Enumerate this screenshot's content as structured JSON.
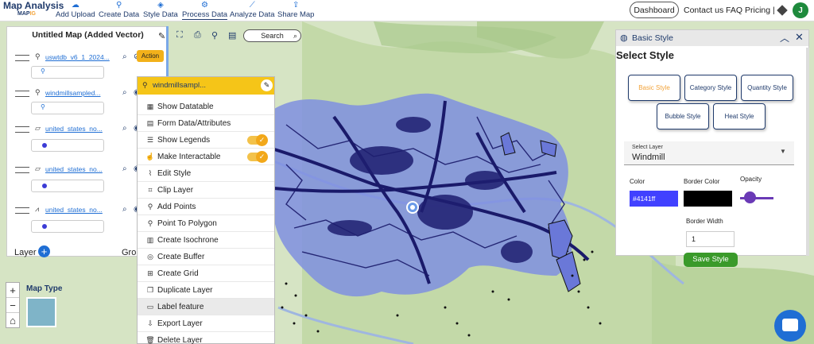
{
  "app": {
    "logo_line1": "Map Analysis",
    "logo_line2a": "MAP",
    "logo_line2b": "IG"
  },
  "nav": {
    "items": [
      {
        "label": "Add Upload",
        "icon": "upload-cloud-icon"
      },
      {
        "label": "Create Data",
        "icon": "location-pin-icon"
      },
      {
        "label": "Style Data",
        "icon": "paint-bucket-icon"
      },
      {
        "label": "Process Data",
        "icon": "process-nodes-icon"
      },
      {
        "label": "Analyze Data",
        "icon": "analyze-chart-icon"
      },
      {
        "label": "Share Map",
        "icon": "share-icon"
      }
    ],
    "active": "Process Data",
    "dashboard": "Dashboard",
    "contact": "Contact us",
    "faq": "FAQ",
    "pricing": "Pricing |",
    "avatar_letter": "J"
  },
  "layer_panel": {
    "title": "Untitled Map (Added Vector)",
    "action_label": "Action",
    "layers": [
      {
        "name": "uswtdb_v6_1_2024...",
        "geom": "point",
        "swatch": "pin"
      },
      {
        "name": "windmillsampled...",
        "geom": "point",
        "swatch": "pin"
      },
      {
        "name": "united_states_no...",
        "geom": "polygon",
        "swatch": "dot"
      },
      {
        "name": "united_states_no...",
        "geom": "polygon",
        "swatch": "dot"
      },
      {
        "name": "united_states_no...",
        "geom": "line",
        "swatch": "dot"
      }
    ],
    "layer_tab": "Layer",
    "group_tab": "Gro"
  },
  "toolbar": {
    "search_label": "Search"
  },
  "context_menu": {
    "layer_name": "windmillsampl...",
    "items": [
      {
        "label": "Show Datatable",
        "icon": "table-icon"
      },
      {
        "label": "Form Data/Attributes",
        "icon": "form-icon"
      },
      {
        "label": "Show Legends",
        "icon": "list-icon",
        "toggle": true
      },
      {
        "label": "Make Interactable",
        "icon": "hand-pointer-icon",
        "toggle": true
      },
      {
        "label": "Edit Style",
        "icon": "brush-icon"
      },
      {
        "label": "Clip Layer",
        "icon": "crop-icon"
      },
      {
        "label": "Add Points",
        "icon": "map-marker-icon"
      },
      {
        "label": "Point To Polygon",
        "icon": "map-pin-icon"
      },
      {
        "label": "Create Isochrone",
        "icon": "isochrone-icon"
      },
      {
        "label": "Create Buffer",
        "icon": "buffer-icon"
      },
      {
        "label": "Create Grid",
        "icon": "grid-icon"
      },
      {
        "label": "Duplicate Layer",
        "icon": "copy-icon"
      },
      {
        "label": "Label feature",
        "icon": "label-icon",
        "hover": true
      },
      {
        "label": "Export Layer",
        "icon": "export-icon"
      },
      {
        "label": "Delete Layer",
        "icon": "trash-icon"
      }
    ]
  },
  "map_controls": {
    "zoom_in": "+",
    "zoom_out": "−",
    "home": "⌂",
    "map_type_label": "Map Type"
  },
  "style_panel": {
    "header": "Basic Style",
    "title": "Select Style",
    "styles": [
      {
        "label": "Basic Style",
        "active": true
      },
      {
        "label": "Category Style",
        "active": false
      },
      {
        "label": "Quantity Style",
        "active": false
      },
      {
        "label": "Bubble Style",
        "active": false
      },
      {
        "label": "Heat Style",
        "active": false
      }
    ],
    "select_layer_caption": "Select Layer",
    "select_layer_value": "Windmill",
    "color_label": "Color",
    "color_value": "#4141ff",
    "border_color_label": "Border Color",
    "border_color_value": "#000000",
    "opacity_label": "Opacity",
    "opacity_value": 0.2,
    "border_width_label": "Border Width",
    "border_width_value": "1",
    "save_label": "Save Style"
  },
  "colors": {
    "accent": "#1f3a6b",
    "action": "#f2b11a",
    "context_header": "#f5c518",
    "save": "#3a9a2a",
    "polygon_fill": "#7f8fe0",
    "polygon_dark": "#1a1a6a"
  }
}
